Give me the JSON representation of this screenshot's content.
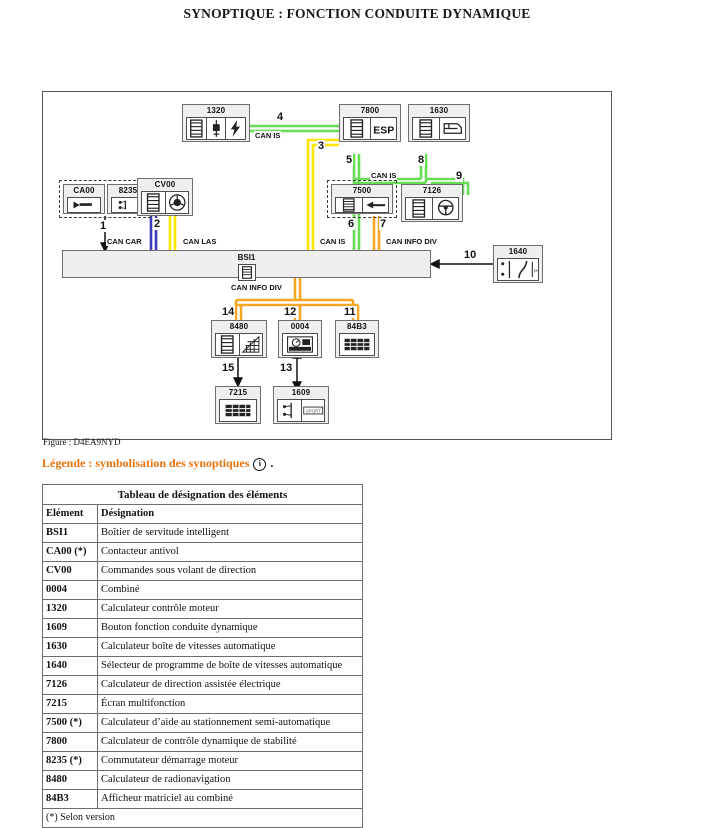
{
  "page": {
    "title": "SYNOPTIQUE : FONCTION CONDUITE DYNAMIQUE",
    "figure_caption": "Figure : D4EA9NYD",
    "legend_text": "Légende : symbolisation des synoptiques",
    "legend_icon": "info-icon",
    "legend_suffix": "."
  },
  "colors": {
    "can_is": "#66dd55",
    "can_las": "#ffe500",
    "can_car": "#3b3bbf",
    "can_info_div": "#f5a623",
    "module_fill": "#efefef",
    "module_border": "#6e6e6e",
    "legend_orange": "#e8720c"
  },
  "diagram": {
    "modules": [
      {
        "id": "1320",
        "label": "1320",
        "icons": [
          "connector-icon",
          "spark-plug-icon",
          "lightning-bolt-icon"
        ]
      },
      {
        "id": "7800",
        "label": "7800",
        "icons": [
          "connector-icon",
          "esp-text-icon"
        ]
      },
      {
        "id": "1630",
        "label": "1630",
        "icons": [
          "connector-icon",
          "gearbox-icon"
        ]
      },
      {
        "id": "CA00",
        "label": "CA00",
        "icons": [
          "antitheft-contactor-icon"
        ]
      },
      {
        "id": "8235",
        "label": "8235",
        "icons": [
          "ignition-switch-icon"
        ]
      },
      {
        "id": "CV00",
        "label": "CV00",
        "icons": [
          "connector-icon",
          "steering-wheel-control-icon"
        ]
      },
      {
        "id": "7500",
        "label": "7500",
        "icons": [
          "connector-icon",
          "parking-sensor-icon"
        ]
      },
      {
        "id": "7126",
        "label": "7126",
        "icons": [
          "connector-icon",
          "steering-wheel-icon"
        ]
      },
      {
        "id": "1640",
        "label": "1640",
        "icons": [
          "selector-lever-icon"
        ]
      },
      {
        "id": "8480",
        "label": "8480",
        "icons": [
          "connector-icon",
          "radio-nav-icon"
        ]
      },
      {
        "id": "0004",
        "label": "0004",
        "icons": [
          "instrument-cluster-icon"
        ]
      },
      {
        "id": "84B3",
        "label": "84B3",
        "icons": [
          "matrix-display-icon"
        ]
      },
      {
        "id": "7215",
        "label": "7215",
        "icons": [
          "multifunction-screen-icon"
        ]
      },
      {
        "id": "1609",
        "label": "1609",
        "icons": [
          "push-button-icon",
          "label-plate-icon"
        ]
      },
      {
        "id": "BSI1",
        "label": "BSI1",
        "icons": [
          "connector-icon"
        ]
      }
    ],
    "bus_labels": [
      {
        "key": "can_is_top",
        "text": "CAN IS"
      },
      {
        "key": "can_is_mid",
        "text": "CAN IS"
      },
      {
        "key": "can_car",
        "text": "CAN CAR"
      },
      {
        "key": "can_las",
        "text": "CAN LAS"
      },
      {
        "key": "can_is_bsi",
        "text": "CAN IS"
      },
      {
        "key": "can_info_div_top",
        "text": "CAN INFO DIV"
      },
      {
        "key": "can_info_div_bottom",
        "text": "CAN INFO DIV"
      }
    ],
    "link_numbers": [
      "1",
      "2",
      "3",
      "4",
      "5",
      "6",
      "7",
      "8",
      "9",
      "10",
      "11",
      "12",
      "13",
      "14",
      "15"
    ]
  },
  "table": {
    "caption": "Tableau de désignation des éléments",
    "headers": [
      "Elément",
      "Désignation"
    ],
    "rows": [
      [
        "BSI1",
        "Boîtier de servitude intelligent"
      ],
      [
        "CA00 (*)",
        "Contacteur antivol"
      ],
      [
        "CV00",
        "Commandes sous volant de direction"
      ],
      [
        "0004",
        "Combiné"
      ],
      [
        "1320",
        "Calculateur contrôle moteur"
      ],
      [
        "1609",
        "Bouton fonction conduite dynamique"
      ],
      [
        "1630",
        "Calculateur boîte de vitesses automatique"
      ],
      [
        "1640",
        "Sélecteur de programme de boîte de vitesses automatique"
      ],
      [
        "7126",
        "Calculateur de direction assistée électrique"
      ],
      [
        "7215",
        "Écran multifonction"
      ],
      [
        "7500 (*)",
        "Calculateur d’aide au stationnement semi-automatique"
      ],
      [
        "7800",
        "Calculateur de contrôle dynamique de stabilité"
      ],
      [
        "8235 (*)",
        "Commutateur démarrage moteur"
      ],
      [
        "8480",
        "Calculateur de radionavigation"
      ],
      [
        "84B3",
        "Afficheur matriciel au combiné"
      ]
    ],
    "footnote": "(*) Selon version"
  }
}
